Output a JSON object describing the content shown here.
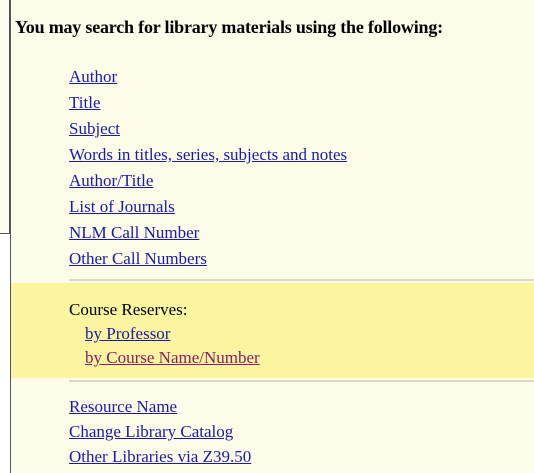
{
  "heading": "You may search for library materials using the following:",
  "search_links": [
    {
      "label": "Author"
    },
    {
      "label": "Title"
    },
    {
      "label": "Subject"
    },
    {
      "label": "Words in titles, series, subjects and notes"
    },
    {
      "label": "Author/Title"
    },
    {
      "label": "List of Journals"
    },
    {
      "label": "NLM Call Number"
    },
    {
      "label": "Other Call Numbers"
    }
  ],
  "course_reserves": {
    "label": "Course Reserves:",
    "links": [
      {
        "label": "by Professor"
      },
      {
        "label": "by Course Name/Number"
      }
    ]
  },
  "other_links": [
    {
      "label": "Resource Name"
    },
    {
      "label": "Change Library Catalog"
    },
    {
      "label": "Other Libraries via Z39.50"
    }
  ],
  "colors": {
    "panel_background": "#fcfce9",
    "highlight_band": "#fbf5a0",
    "link": "#1a1aa6",
    "visited_link": "#8a1a6a"
  }
}
